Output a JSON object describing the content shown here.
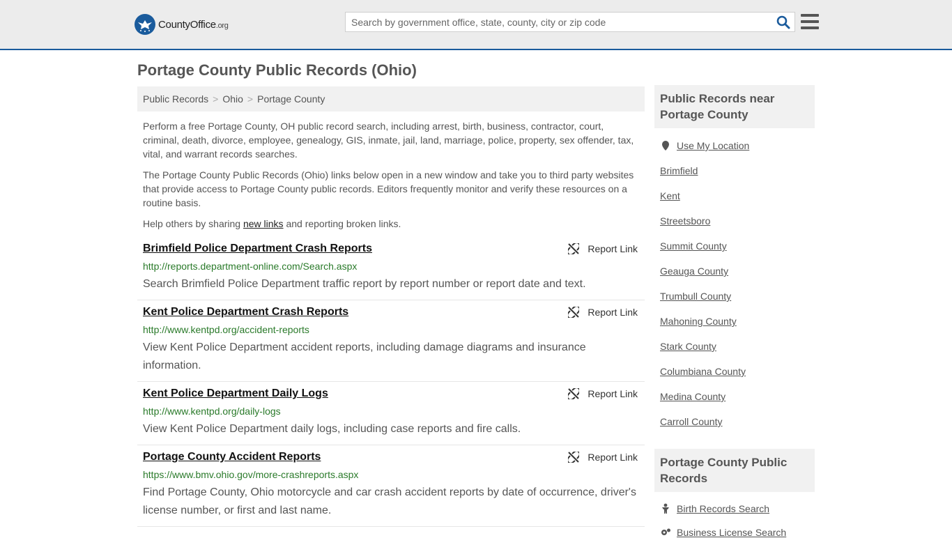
{
  "header": {
    "logo_main": "CountyOffice",
    "logo_tld": ".org",
    "search_placeholder": "Search by government office, state, county, city or zip code"
  },
  "page": {
    "title": "Portage County Public Records (Ohio)"
  },
  "breadcrumb": [
    "Public Records",
    "Ohio",
    "Portage County"
  ],
  "intro": {
    "p1": "Perform a free Portage County, OH public record search, including arrest, birth, business, contractor, court, criminal, death, divorce, employee, genealogy, GIS, inmate, jail, land, marriage, police, property, sex offender, tax, vital, and warrant records searches.",
    "p2": "The Portage County Public Records (Ohio) links below open in a new window and take you to third party websites that provide access to Portage County public records. Editors frequently monitor and verify these resources on a routine basis.",
    "p3_before": "Help others by sharing ",
    "p3_link": "new links",
    "p3_after": " and reporting broken links."
  },
  "report_label": "Report Link",
  "listings": [
    {
      "title": "Brimfield Police Department Crash Reports",
      "url": "http://reports.department-online.com/Search.aspx",
      "desc": "Search Brimfield Police Department traffic report by report number or report date and text."
    },
    {
      "title": "Kent Police Department Crash Reports",
      "url": "http://www.kentpd.org/accident-reports",
      "desc": "View Kent Police Department accident reports, including damage diagrams and insurance information."
    },
    {
      "title": "Kent Police Department Daily Logs",
      "url": "http://www.kentpd.org/daily-logs",
      "desc": "View Kent Police Department daily logs, including case reports and fire calls."
    },
    {
      "title": "Portage County Accident Reports",
      "url": "https://www.bmv.ohio.gov/more-crashreports.aspx",
      "desc": "Find Portage County, Ohio motorcycle and car crash accident reports by date of occurrence, driver's license number, or first and last name."
    }
  ],
  "sidebar": {
    "near_title": "Public Records near Portage County",
    "use_location": "Use My Location",
    "near_links": [
      "Brimfield",
      "Kent",
      "Streetsboro",
      "Summit County",
      "Geauga County",
      "Trumbull County",
      "Mahoning County",
      "Stark County",
      "Columbiana County",
      "Medina County",
      "Carroll County"
    ],
    "records_title": "Portage County Public Records",
    "record_links": [
      "Birth Records Search",
      "Business License Search"
    ]
  }
}
